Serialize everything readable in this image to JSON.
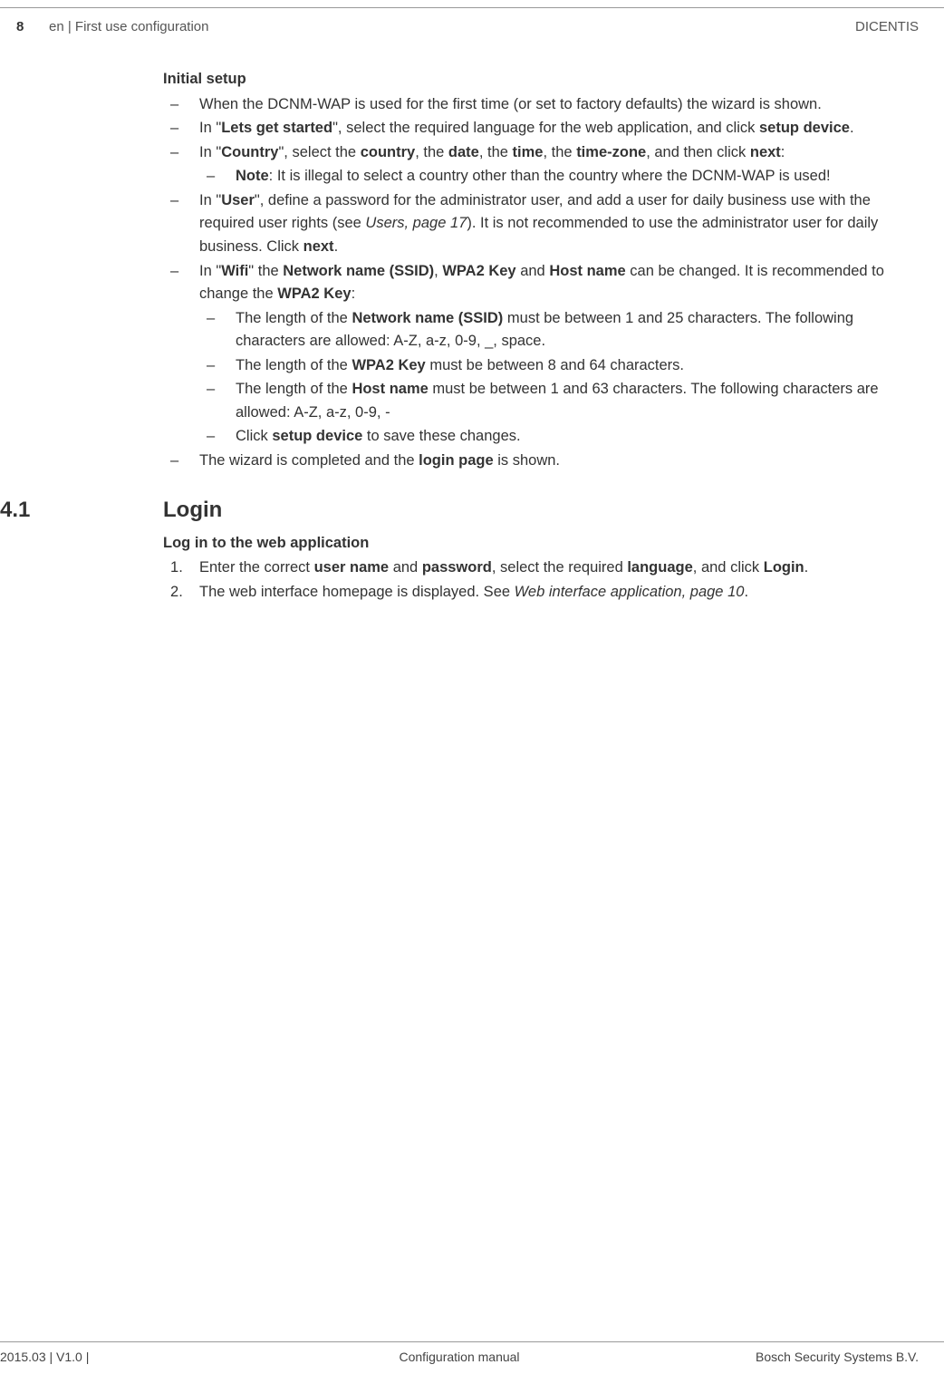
{
  "header": {
    "page_number": "8",
    "title": "en | First use configuration",
    "product": "DICENTIS"
  },
  "sec_initial_title": "Initial setup",
  "b1": "When the DCNM-WAP is used for the first time (or set to factory defaults) the wizard is shown.",
  "b2a": "In \"",
  "b2b": "Lets get started",
  "b2c": "\", select the required language for the web application, and click ",
  "b2d": "setup device",
  "b2e": ".",
  "b3a": "In \"",
  "b3b": "Country",
  "b3c": "\", select the ",
  "b3d": "country",
  "b3e": ", the ",
  "b3f": "date",
  "b3g": ", the ",
  "b3h": "time",
  "b3i": ", the ",
  "b3j": "time-zone",
  "b3k": ", and then click ",
  "b3l": "next",
  "b3m": ":",
  "b3n1a": "Note",
  "b3n1b": ": It is illegal to select a country other than the country where the DCNM-WAP is used!",
  "b4a": "In \"",
  "b4b": "User",
  "b4c": "\", define a password for the administrator user, and add a user for daily business use with the required user rights (see ",
  "b4d": "Users, page 17",
  "b4e": "). It is not recommended to use the administrator user for daily business. Click ",
  "b4f": "next",
  "b4g": ".",
  "b5a": "In \"",
  "b5b": "Wifi",
  "b5c": "\" the ",
  "b5d": "Network name (SSID)",
  "b5e": ", ",
  "b5f": "WPA2 Key",
  "b5g": " and ",
  "b5h": "Host name",
  "b5i": " can be changed. It is recommended to change the ",
  "b5j": "WPA2 Key",
  "b5k": ":",
  "b5s1a": "The length of the ",
  "b5s1b": "Network name (SSID)",
  "b5s1c": " must be between 1 and 25 characters. The following characters are allowed: A-Z, a-z, 0-9, _, space.",
  "b5s2a": "The length of the ",
  "b5s2b": "WPA2 Key",
  "b5s2c": " must be between 8 and 64 characters.",
  "b5s3a": "The length of the ",
  "b5s3b": "Host name",
  "b5s3c": " must be between 1 and 63 characters. The following characters are allowed: A-Z, a-z, 0-9, -",
  "b5s4a": "Click ",
  "b5s4b": "setup device",
  "b5s4c": " to save these changes.",
  "b6a": "The wizard is completed and the ",
  "b6b": "login page",
  "b6c": " is shown.",
  "sec41_num": "4.1",
  "sec41_title": "Login",
  "login_sub": "Log in to the web application",
  "l1a": "Enter the correct ",
  "l1b": "user name",
  "l1c": " and ",
  "l1d": "password",
  "l1e": ", select the required ",
  "l1f": "language",
  "l1g": ", and click ",
  "l1h": "Login",
  "l1i": ".",
  "l2a": "The web interface homepage is displayed. See ",
  "l2b": "Web interface application, page 10",
  "l2c": ".",
  "footer": {
    "left": "2015.03 | V1.0 |",
    "center": "Configuration manual",
    "right": "Bosch Security Systems B.V."
  }
}
